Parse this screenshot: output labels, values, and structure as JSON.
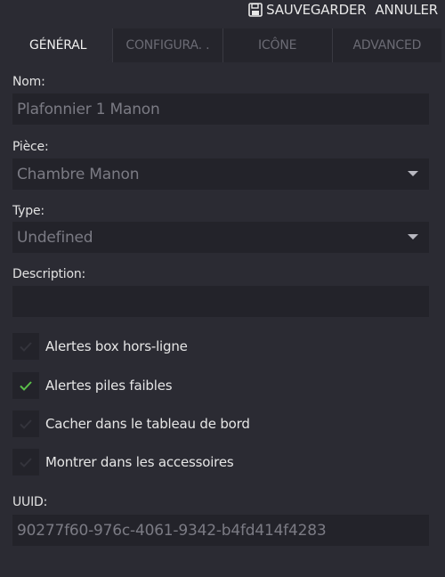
{
  "actions": {
    "save_label": "SAUVEGARDER",
    "cancel_label": "ANNULER"
  },
  "tabs": [
    {
      "label": "GÉNÉRAL",
      "active": true
    },
    {
      "label": "CONFIGURA. .",
      "active": false
    },
    {
      "label": "ICÔNE",
      "active": false
    },
    {
      "label": "ADVANCED",
      "active": false
    }
  ],
  "form": {
    "name_label": "Nom:",
    "name_value": "Plafonnier 1 Manon",
    "room_label": "Pièce:",
    "room_value": "Chambre Manon",
    "type_label": "Type:",
    "type_value": "Undefined",
    "description_label": "Description:",
    "description_value": "",
    "uuid_label": "UUID:",
    "uuid_value": "90277f60-976c-4061-9342-b4fd414f4283"
  },
  "checkboxes": [
    {
      "label": "Alertes box hors-ligne",
      "checked": false
    },
    {
      "label": "Alertes piles faibles",
      "checked": true
    },
    {
      "label": "Cacher dans le tableau de bord",
      "checked": false
    },
    {
      "label": "Montrer dans les accessoires",
      "checked": false
    }
  ],
  "colors": {
    "check_on": "#5bbf4a",
    "check_off": "#34343c"
  }
}
